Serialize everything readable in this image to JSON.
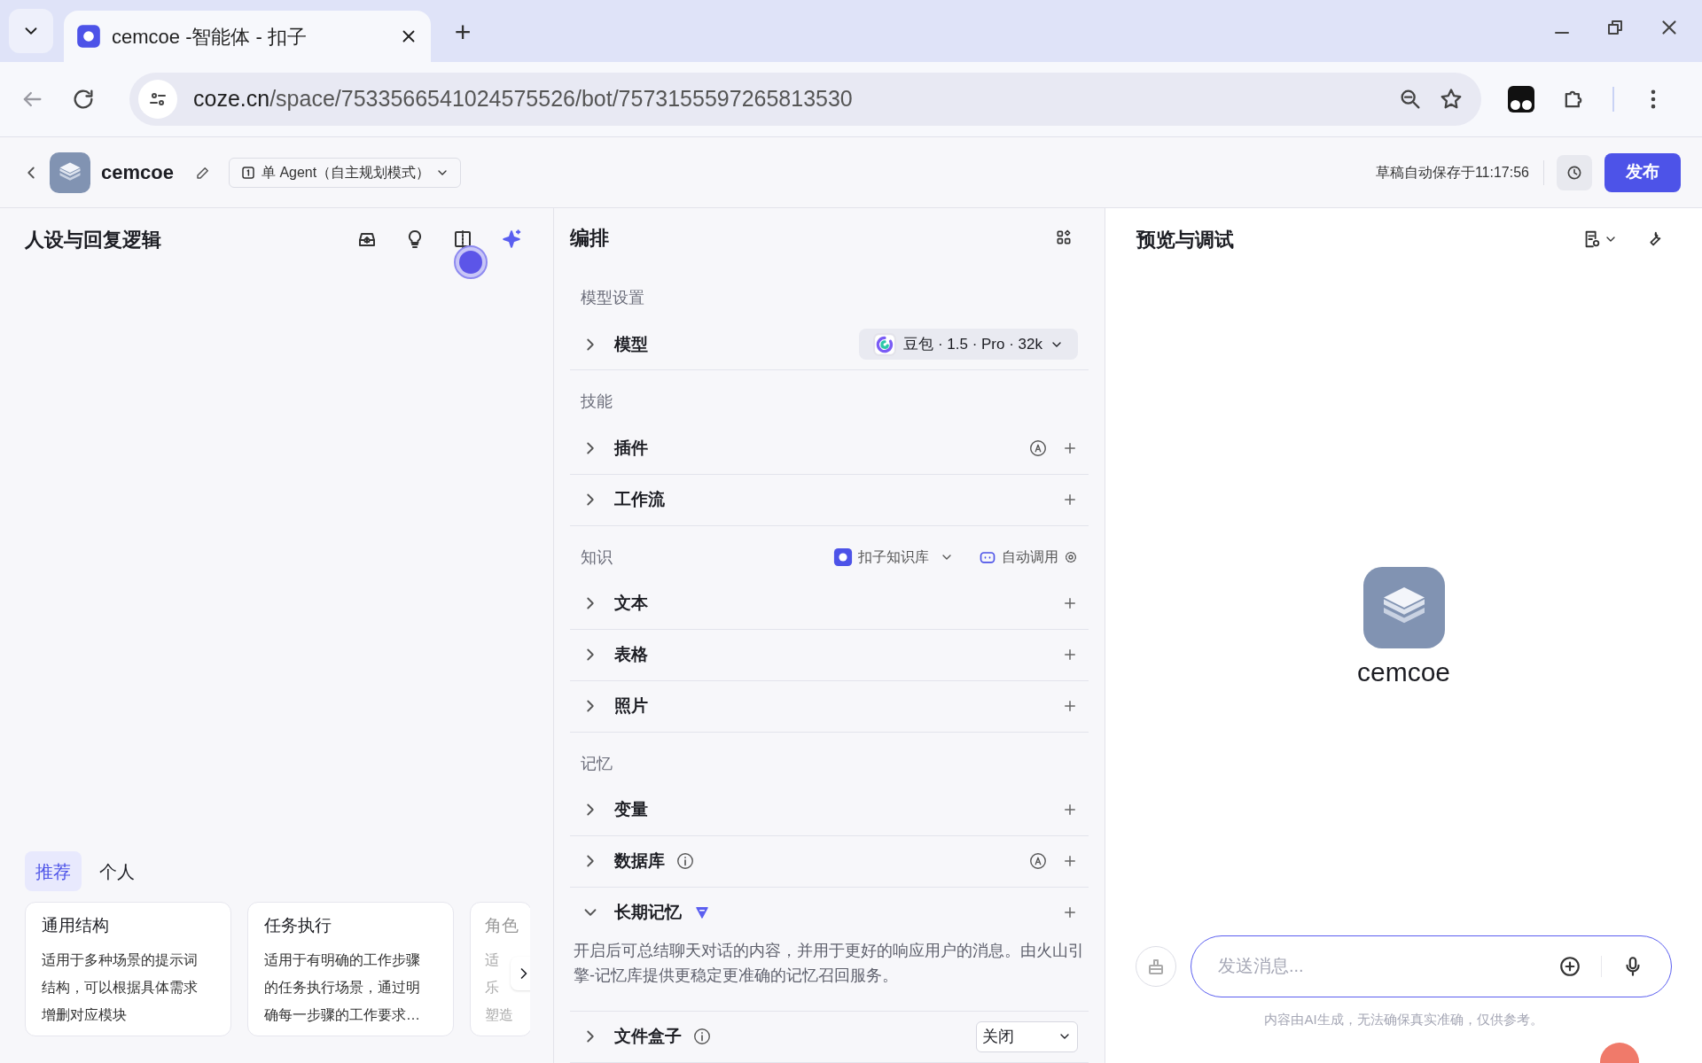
{
  "browser": {
    "tab_title": "cemcoe -智能体 - 扣子",
    "new_tab": "+",
    "url_host": "coze.cn",
    "url_path": "/space/7533566541024575526/bot/7573155597265813530"
  },
  "header": {
    "bot_name": "cemcoe",
    "mode": "单 Agent（自主规划模式）",
    "saved": "草稿自动保存于11:17:56",
    "publish": "发布"
  },
  "prompt_panel": {
    "title": "人设与回复逻辑",
    "tabs": [
      {
        "label": "推荐",
        "selected": true
      },
      {
        "label": "个人",
        "selected": false
      }
    ],
    "cards": [
      {
        "title": "通用结构",
        "lines": [
          "适用于多种场景的提示词",
          "结构，可以根据具体需求",
          "增删对应模块"
        ]
      },
      {
        "title": "任务执行",
        "lines": [
          "适用于有明确的工作步骤",
          "的任务执行场景，通过明",
          "确每一步骤的工作要求…"
        ]
      },
      {
        "title": "角色",
        "lines": [
          "适",
          "乐",
          "塑造"
        ]
      }
    ]
  },
  "arrange_panel": {
    "title": "编排",
    "sections": [
      {
        "title": "模型设置",
        "items": [
          {
            "kind": "model",
            "label": "模型",
            "expanded": false,
            "info": false,
            "auto": false,
            "premium": false,
            "value": "豆包 · 1.5 · Pro · 32k"
          }
        ]
      },
      {
        "title": "技能",
        "items": [
          {
            "kind": "add",
            "label": "插件",
            "expanded": false,
            "info": false,
            "auto": true,
            "premium": false
          },
          {
            "kind": "add",
            "label": "工作流",
            "expanded": false,
            "info": false,
            "auto": false,
            "premium": false
          }
        ]
      },
      {
        "title": "知识",
        "source": "扣子知识库",
        "call_mode": "自动调用",
        "items": [
          {
            "kind": "add",
            "label": "文本",
            "expanded": false,
            "info": false,
            "auto": false,
            "premium": false
          },
          {
            "kind": "add",
            "label": "表格",
            "expanded": false,
            "info": false,
            "auto": false,
            "premium": false
          },
          {
            "kind": "add",
            "label": "照片",
            "expanded": false,
            "info": false,
            "auto": false,
            "premium": false
          }
        ]
      },
      {
        "title": "记忆",
        "items": [
          {
            "kind": "add",
            "label": "变量",
            "expanded": false,
            "info": false,
            "auto": false,
            "premium": false
          },
          {
            "kind": "add",
            "label": "数据库",
            "expanded": false,
            "info": true,
            "auto": true,
            "premium": false
          },
          {
            "kind": "add",
            "label": "长期记忆",
            "expanded": true,
            "info": false,
            "auto": false,
            "premium": true,
            "description": "开启后可总结聊天对话的内容，并用于更好的响应用户的消息。由火山引擎-记忆库提供更稳定更准确的记忆召回服务。"
          },
          {
            "kind": "select",
            "label": "文件盒子",
            "expanded": false,
            "info": true,
            "auto": false,
            "premium": false,
            "value": "关闭"
          }
        ]
      }
    ]
  },
  "preview_panel": {
    "title": "预览与调试",
    "bot_name": "cemcoe",
    "input": {
      "placeholder": "发送消息..."
    },
    "disclaimer": "内容由AI生成，无法确保真实准确，仅供参考。"
  }
}
